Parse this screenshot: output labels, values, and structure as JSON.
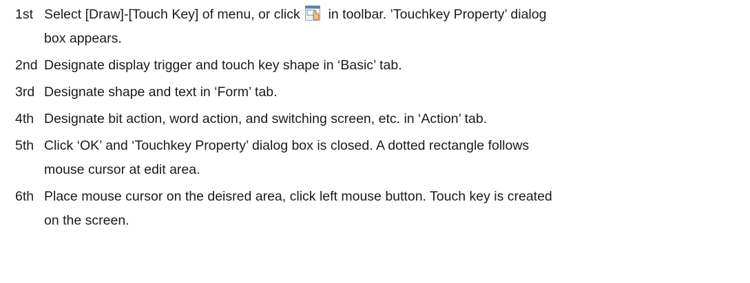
{
  "steps": [
    {
      "num": "1st",
      "before_icon": "Select [Draw]-[Touch Key] of menu, or click",
      "icon": "touch-key-toolbar-icon",
      "after_icon": "in toolbar. ’Touchkey Property’ dialog",
      "cont": "box appears."
    },
    {
      "num": "2nd",
      "text": "Designate display trigger and touch key shape in ‘Basic’ tab."
    },
    {
      "num": "3rd",
      "text": "Designate shape and text in ‘Form’ tab."
    },
    {
      "num": "4th",
      "text": "Designate bit action, word action, and switching screen, etc. in ‘Action’ tab."
    },
    {
      "num": "5th",
      "text": "Click ‘OK’ and ‘Touchkey Property’ dialog box is closed. A dotted rectangle follows",
      "cont": "mouse cursor at edit area."
    },
    {
      "num": "6th",
      "text": "Place mouse cursor on the deisred area, click left mouse button. Touch key is created",
      "cont": "on the screen."
    }
  ]
}
